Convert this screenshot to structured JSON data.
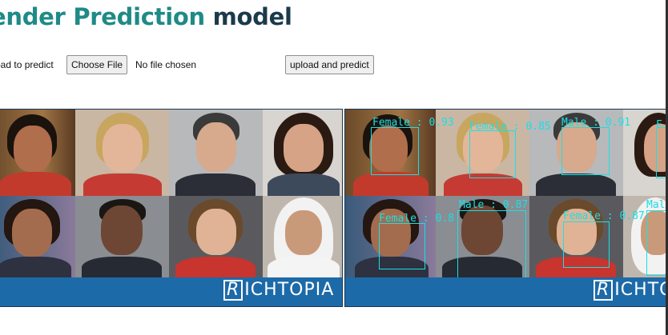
{
  "header": {
    "title_part1": "ender Prediction",
    "title_part2": " model"
  },
  "upload": {
    "label": "oad to predict",
    "choose_button": "Choose File",
    "file_status": "No file chosen",
    "submit_button": "upload and predict"
  },
  "images": {
    "banner_brand_letter": "R",
    "banner_brand_rest": "ICHTOPIA",
    "detections": [
      {
        "gender": "Female",
        "score": "0.93"
      },
      {
        "gender": "Female",
        "score": "0.85"
      },
      {
        "gender": "Male",
        "score": "0.91"
      },
      {
        "gender": "F",
        "score": ""
      },
      {
        "gender": "Female",
        "score": "0.8"
      },
      {
        "gender": "Male",
        "score": "0.87"
      },
      {
        "gender": "Female",
        "score": "0.87"
      },
      {
        "gender": "Mal",
        "score": ""
      }
    ]
  },
  "colors": {
    "title_accent": "#1f8a86",
    "title_dark": "#1b3a4b",
    "banner": "#1d6aa8",
    "detection": "#19e0e6"
  }
}
